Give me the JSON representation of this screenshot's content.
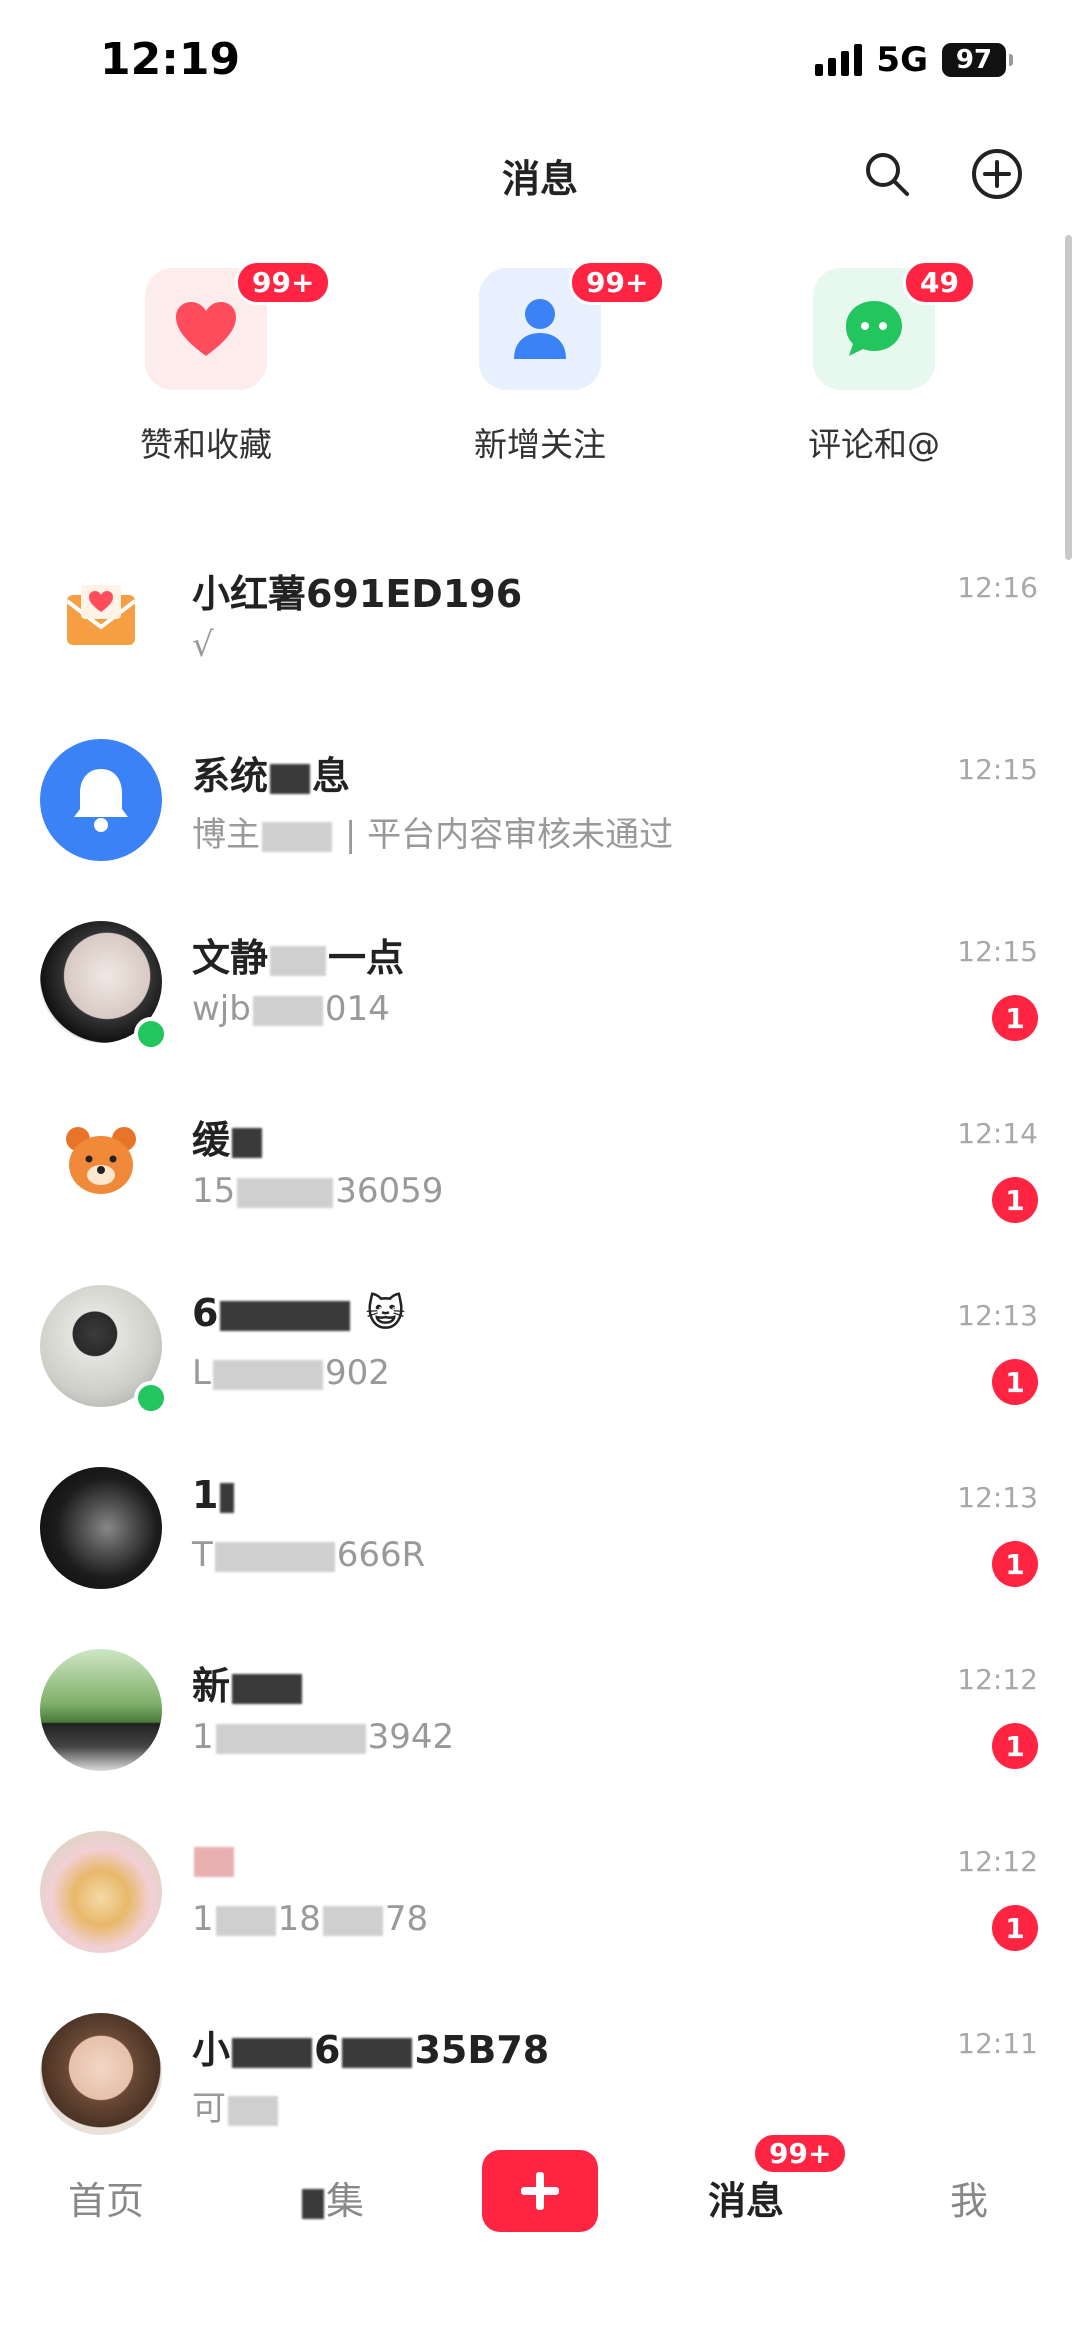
{
  "status_bar": {
    "time": "12:19",
    "network": "5G",
    "battery": "97"
  },
  "header": {
    "title": "消息"
  },
  "categories": [
    {
      "label": "赞和收藏",
      "badge": "99+",
      "icon": "heart-icon",
      "color": "#ff4d5e"
    },
    {
      "label": "新增关注",
      "badge": "99+",
      "icon": "person-icon",
      "color": "#3b82f6"
    },
    {
      "label": "评论和@",
      "badge": "49",
      "icon": "chat-bubble-icon",
      "color": "#22c55e"
    }
  ],
  "conversations": [
    {
      "name": "小红薯691ED196",
      "preview": "√",
      "time": "12:16",
      "unread": ""
    },
    {
      "name": "系统",
      "name_tail": "息",
      "preview": "博主",
      "preview_tail": "| 平台内容审核未通过",
      "time": "12:15",
      "unread": ""
    },
    {
      "name": "文静",
      "name_tail": "一点",
      "preview": "wjb",
      "preview_tail": "014",
      "time": "12:15",
      "unread": "1"
    },
    {
      "name": "缓",
      "preview": "15",
      "preview_tail": "36059",
      "time": "12:14",
      "unread": "1"
    },
    {
      "name": "6",
      "name_emoji": "😺",
      "preview": "L",
      "preview_tail": "902",
      "time": "12:13",
      "unread": "1"
    },
    {
      "name": "1",
      "preview": "T",
      "preview_tail": "666R",
      "time": "12:13",
      "unread": "1"
    },
    {
      "name": "新",
      "preview": "1",
      "preview_tail": "3942",
      "time": "12:12",
      "unread": "1"
    },
    {
      "name": "",
      "preview": "1",
      "preview_mid": "18",
      "preview_tail": "78",
      "time": "12:12",
      "unread": "1"
    },
    {
      "name": "小",
      "name_mid": "6",
      "name_tail": "35B78",
      "preview": "可",
      "time": "12:11",
      "unread": ""
    }
  ],
  "tabbar": {
    "home": "首页",
    "market": "集",
    "publish": "+",
    "messages": "消息",
    "messages_badge": "99+",
    "me": "我"
  },
  "colors": {
    "accent": "#ff2442",
    "online": "#22c55e"
  }
}
